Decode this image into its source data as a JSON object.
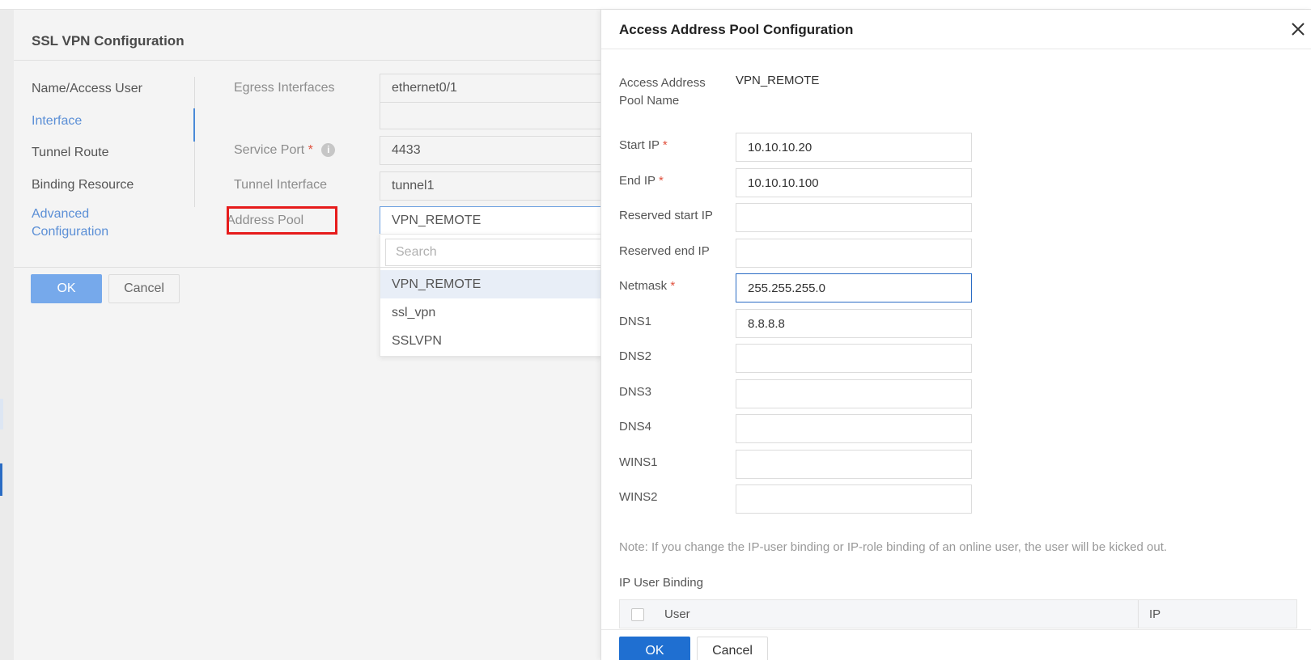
{
  "dialog": {
    "title": "SSL VPN Configuration",
    "nav": {
      "items": [
        {
          "label": "Name/Access User"
        },
        {
          "label": "Interface"
        },
        {
          "label": "Tunnel Route"
        },
        {
          "label": "Binding Resource"
        },
        {
          "label_line1": "Advanced",
          "label_line2": "Configuration"
        }
      ]
    },
    "fields": {
      "egress_label": "Egress Interfaces",
      "egress_value": "ethernet0/1",
      "service_port_label": "Service Port",
      "service_port_value": "4433",
      "tunnel_interface_label": "Tunnel Interface",
      "tunnel_interface_value": "tunnel1",
      "address_pool_label": "Address Pool",
      "address_pool_value": "VPN_REMOTE"
    },
    "dropdown": {
      "search_placeholder": "Search",
      "options": [
        "VPN_REMOTE",
        "ssl_vpn",
        "SSLVPN"
      ],
      "selected": "VPN_REMOTE"
    },
    "buttons": {
      "ok": "OK",
      "cancel": "Cancel"
    }
  },
  "panel": {
    "title": "Access Address Pool Configuration",
    "pool_name_label_line1": "Access Address",
    "pool_name_label_line2": "Pool Name",
    "pool_name_value": "VPN_REMOTE",
    "required_mark": "*",
    "info_icon_glyph": "i",
    "fields": {
      "start_ip": {
        "label": "Start IP",
        "value": "10.10.10.20"
      },
      "end_ip": {
        "label": "End IP",
        "value": "10.10.10.100"
      },
      "reserved_start_ip": {
        "label": "Reserved start IP",
        "value": ""
      },
      "reserved_end_ip": {
        "label": "Reserved end IP",
        "value": ""
      },
      "netmask": {
        "label": "Netmask",
        "value": "255.255.255.0"
      },
      "dns1": {
        "label": "DNS1",
        "value": "8.8.8.8"
      },
      "dns2": {
        "label": "DNS2",
        "value": ""
      },
      "dns3": {
        "label": "DNS3",
        "value": ""
      },
      "dns4": {
        "label": "DNS4",
        "value": ""
      },
      "wins1": {
        "label": "WINS1",
        "value": ""
      },
      "wins2": {
        "label": "WINS2",
        "value": ""
      }
    },
    "note": "Note: If you change the IP-user binding or IP-role binding of an online user, the user will be kicked out.",
    "ip_user_binding": {
      "title": "IP User Binding",
      "columns": [
        "User",
        "IP"
      ]
    },
    "buttons": {
      "ok": "OK",
      "cancel": "Cancel"
    }
  },
  "colors": {
    "primary": "#1f6fd1",
    "link": "#5b8fd6",
    "highlight": "#e61b1b",
    "required": "#e0503d"
  },
  "icons": {
    "close": "close-icon",
    "info": "info-icon",
    "checkbox": "checkbox-icon"
  }
}
